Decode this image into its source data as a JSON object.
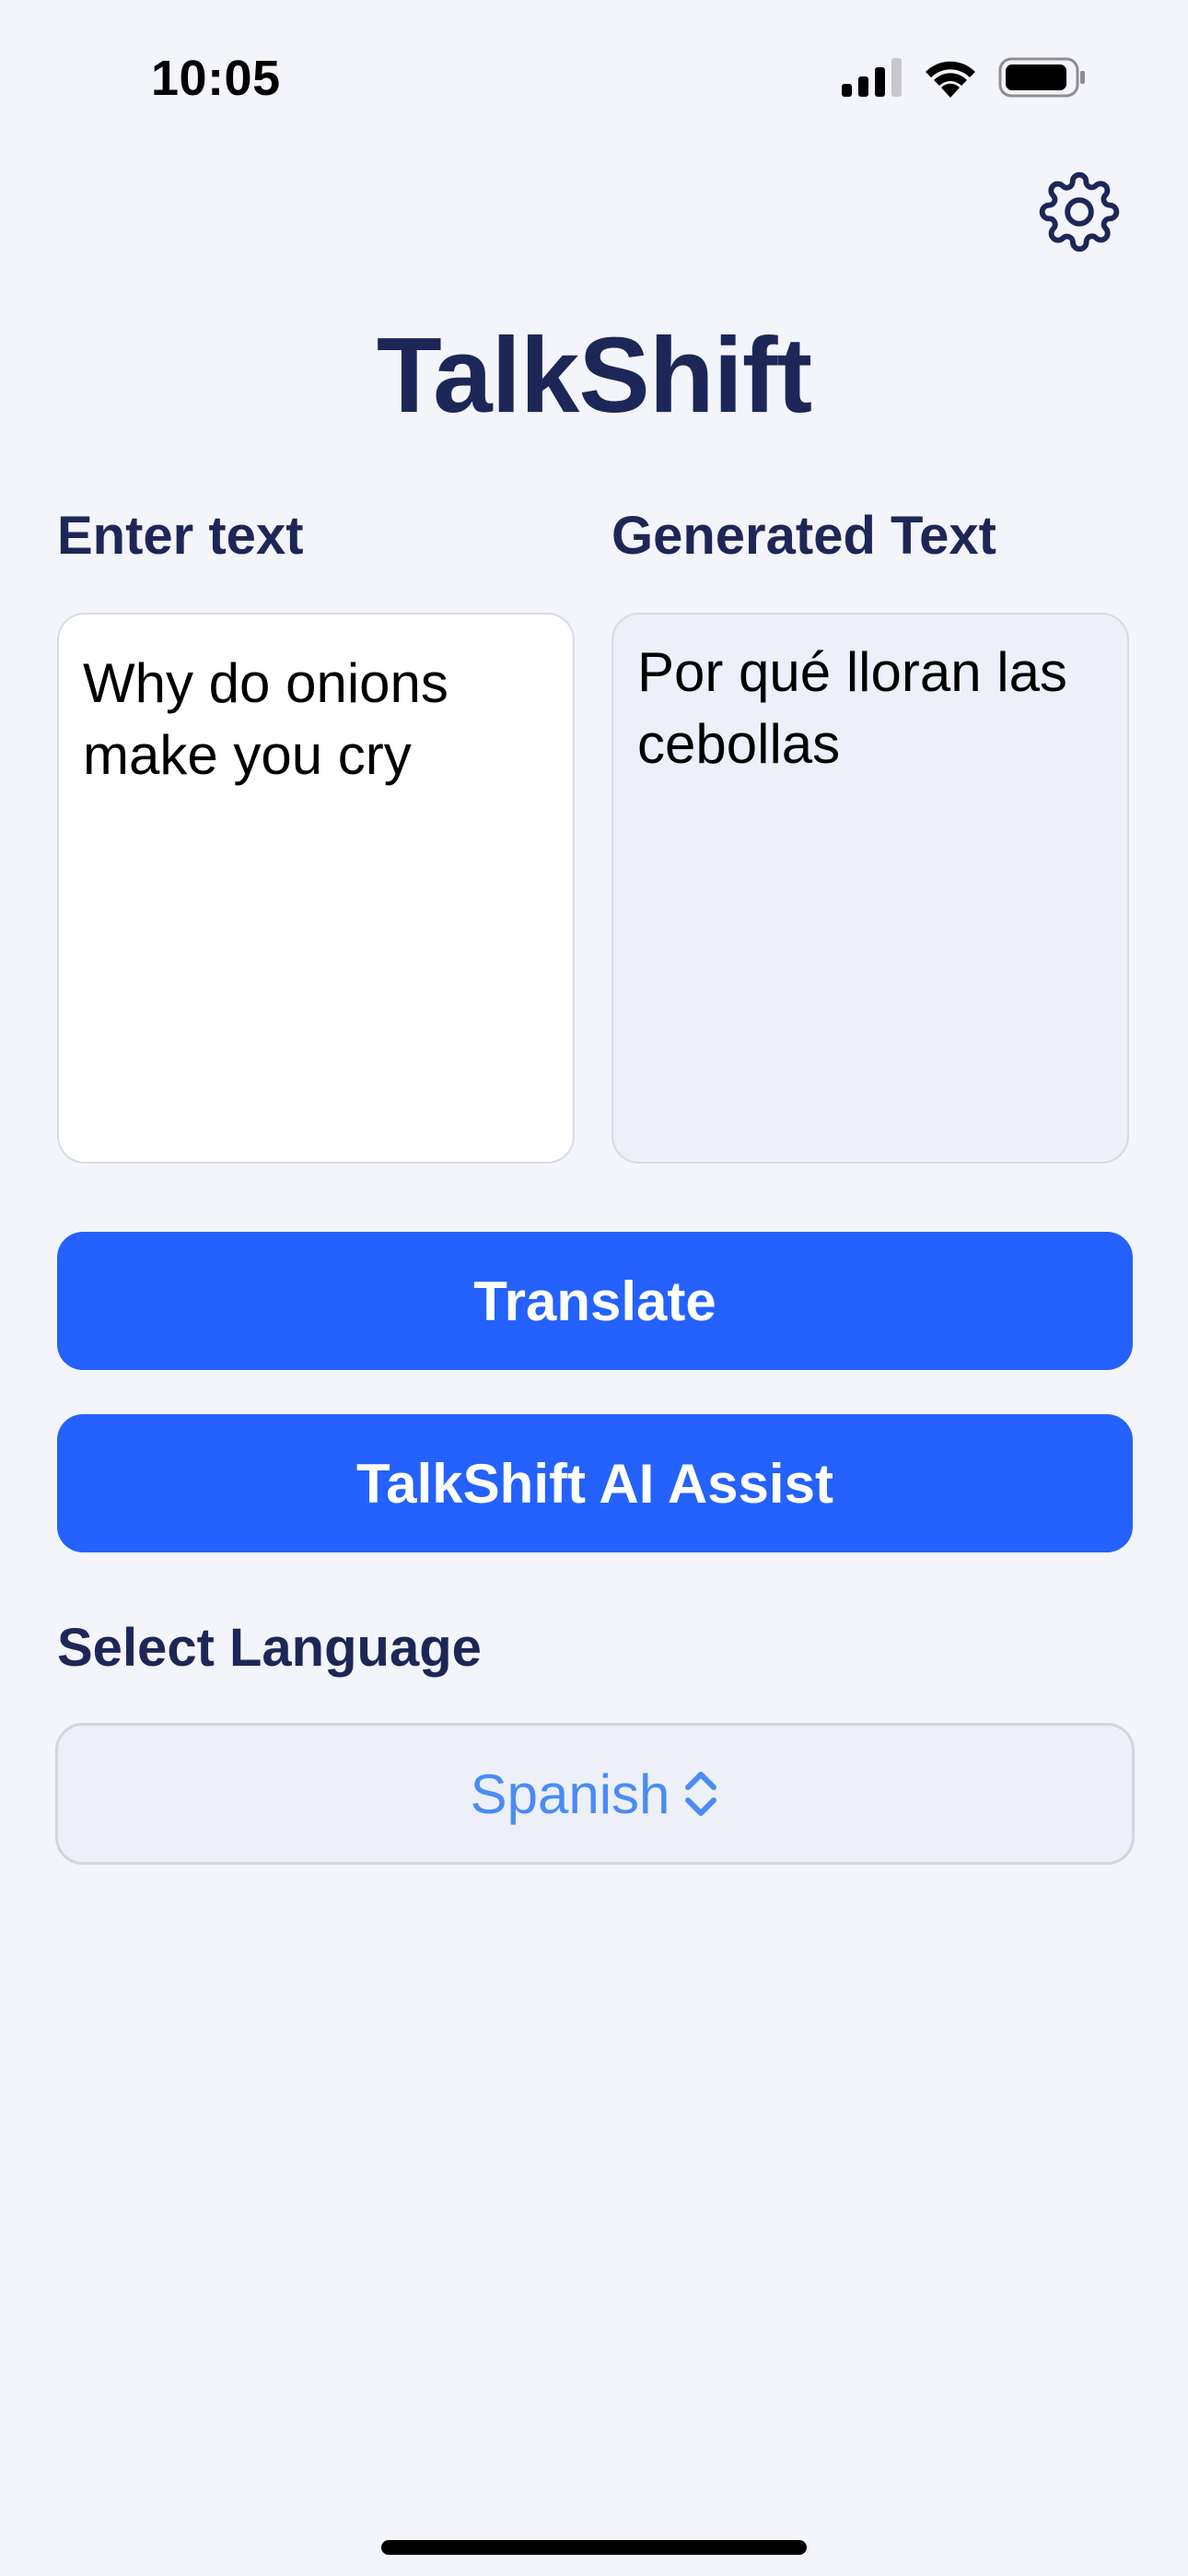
{
  "status_bar": {
    "time": "10:05"
  },
  "header": {
    "title": "TalkShift",
    "settings_icon": "gear-icon"
  },
  "input_panel": {
    "label": "Enter text",
    "value": "Why do onions make you cry"
  },
  "output_panel": {
    "label": "Generated Text",
    "value": "Por qué lloran las cebollas"
  },
  "actions": {
    "translate_label": "Translate",
    "assist_label": "TalkShift AI Assist"
  },
  "language": {
    "label": "Select Language",
    "selected": "Spanish"
  },
  "colors": {
    "background": "#f3f5fa",
    "title": "#1d2757",
    "primary_button": "#2461fd",
    "select_text": "#4a8bf5"
  }
}
